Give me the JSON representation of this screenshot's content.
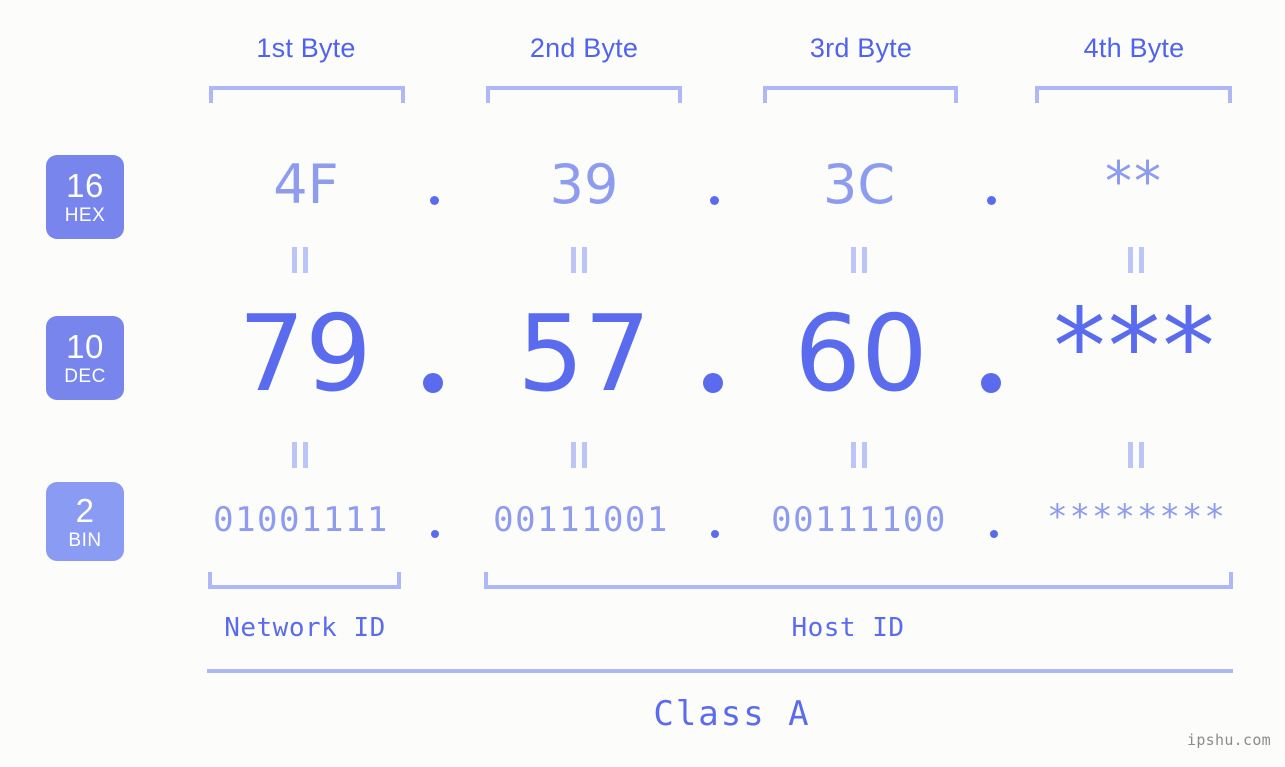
{
  "background_color": "#fcfdfa",
  "colors": {
    "header_text": "#4f63ef",
    "bracket": "#aeb8f7",
    "badge_strong": "#7785ec",
    "badge_light": "#8a9bf4",
    "value_light": "#8e9cef",
    "value_strong": "#5a6ced",
    "watermark": "#8c8c8c"
  },
  "headers": [
    {
      "label": "1st Byte"
    },
    {
      "label": "2nd Byte"
    },
    {
      "label": "3rd Byte"
    },
    {
      "label": "4th Byte"
    }
  ],
  "badges": [
    {
      "number": "16",
      "name": "HEX"
    },
    {
      "number": "10",
      "name": "DEC"
    },
    {
      "number": "2",
      "name": "BIN"
    }
  ],
  "rows": {
    "hex": {
      "radix": "16",
      "radix_name": "HEX",
      "values": [
        "4F",
        "39",
        "3C",
        "**"
      ],
      "separator": "."
    },
    "dec": {
      "radix": "10",
      "radix_name": "DEC",
      "values": [
        "79",
        "57",
        "60",
        "***"
      ],
      "separator": "."
    },
    "bin": {
      "radix": "2",
      "radix_name": "BIN",
      "values": [
        "01001111",
        "00111001",
        "00111100",
        "********"
      ],
      "separator": "."
    }
  },
  "equals_mark": "=",
  "sections": {
    "network_id": "Network ID",
    "host_id": "Host ID",
    "class": "Class A"
  },
  "watermark": "ipshu.com"
}
